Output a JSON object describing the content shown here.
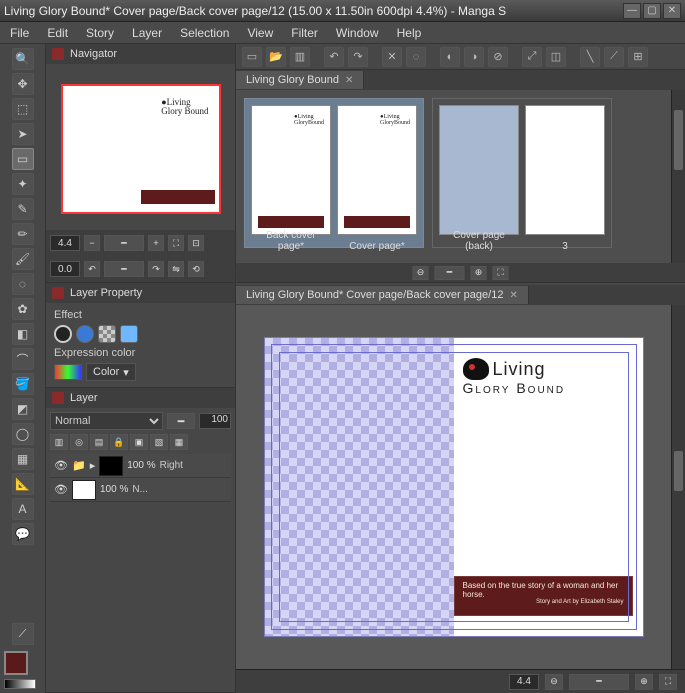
{
  "titlebar": {
    "title": "Living Glory Bound* Cover page/Back cover page/12 (15.00 x 11.50in 600dpi 4.4%)  - Manga S"
  },
  "menus": [
    "File",
    "Edit",
    "Story",
    "Layer",
    "Selection",
    "View",
    "Filter",
    "Window",
    "Help"
  ],
  "navigator": {
    "title": "Navigator",
    "zoom": "4.4",
    "rotation": "0.0"
  },
  "layer_property": {
    "title": "Layer Property",
    "section": "Effect",
    "expr_label": "Expression color",
    "color_mode": "Color"
  },
  "layer_panel": {
    "title": "Layer",
    "blend": "Normal",
    "opacity": "100",
    "rows": [
      {
        "pct": "100 %",
        "name": "Right"
      },
      {
        "pct": "100 %",
        "name": "N..."
      }
    ]
  },
  "story": {
    "tab": "Living Glory Bound",
    "pages": [
      {
        "label": "Back cover page*",
        "logo": true,
        "ribbon": true
      },
      {
        "label": "Cover page*",
        "logo": true,
        "ribbon": true
      },
      {
        "label": "Cover page (back)",
        "blue": true
      },
      {
        "label": "3",
        "logo": false
      }
    ]
  },
  "canvas": {
    "tab": "Living Glory Bound* Cover page/Back cover page/12",
    "logo_line1": "Living",
    "logo_line2": "Glory Bound",
    "ribbon_main": "Based on the true story of a woman and her horse.",
    "ribbon_sub": "Story and Art by Elizabeth Staley",
    "zoom": "4.4"
  }
}
